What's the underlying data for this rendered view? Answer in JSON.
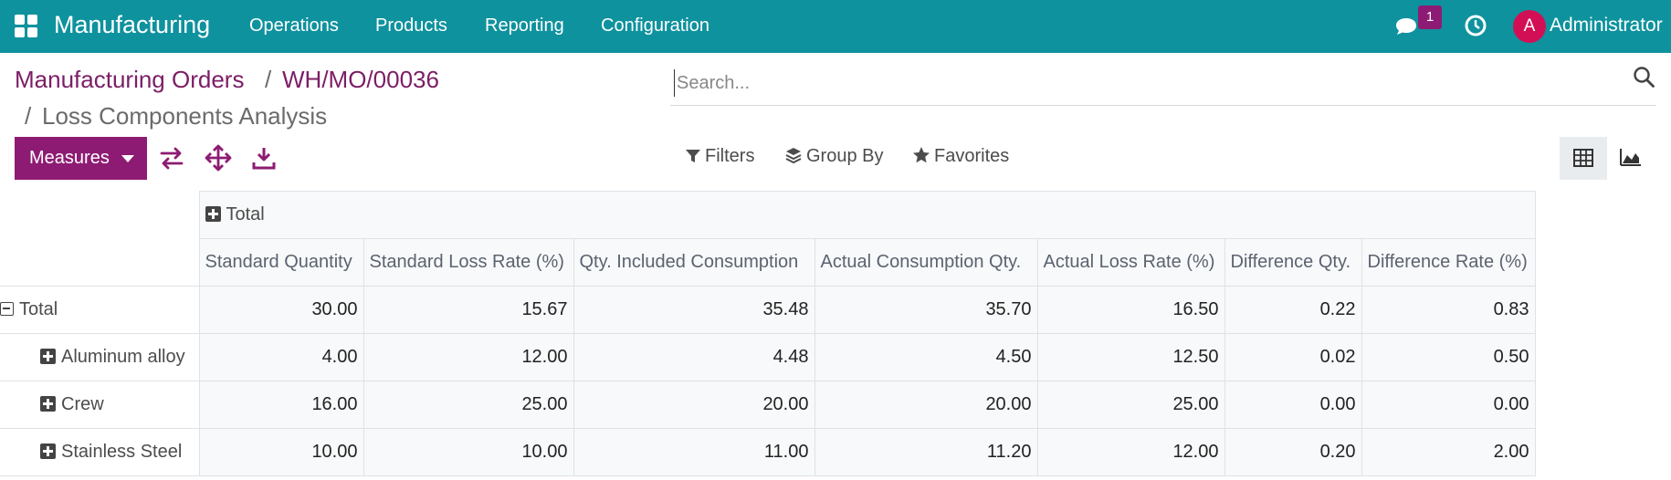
{
  "navbar": {
    "brand": "Manufacturing",
    "menu": [
      "Operations",
      "Products",
      "Reporting",
      "Configuration"
    ],
    "notification_count": "1",
    "avatar_initial": "A",
    "user": "Administrator",
    "bg_color": "#0e929e"
  },
  "breadcrumb": {
    "parent": "Manufacturing Orders",
    "sep": "/",
    "record": "WH/MO/00036",
    "current": "Loss Components Analysis"
  },
  "search": {
    "placeholder": "Search..."
  },
  "toolbar": {
    "measures": "Measures",
    "filters": "Filters",
    "group_by": "Group By",
    "favorites": "Favorites"
  },
  "pivot": {
    "col_group": "Total",
    "headers": [
      "Standard Quantity",
      "Standard Loss Rate (%)",
      "Qty. Included Consumption",
      "Actual Consumption Qty.",
      "Actual Loss Rate (%)",
      "Difference Qty.",
      "Difference Rate (%)"
    ],
    "total_label": "Total",
    "total_values": [
      "30.00",
      "15.67",
      "35.48",
      "35.70",
      "16.50",
      "0.22",
      "0.83"
    ],
    "rows": [
      {
        "label": "Aluminum alloy",
        "values": [
          "4.00",
          "12.00",
          "4.48",
          "4.50",
          "12.50",
          "0.02",
          "0.50"
        ]
      },
      {
        "label": "Crew",
        "values": [
          "16.00",
          "25.00",
          "20.00",
          "20.00",
          "25.00",
          "0.00",
          "0.00"
        ]
      },
      {
        "label": "Stainless Steel",
        "values": [
          "10.00",
          "10.00",
          "11.00",
          "11.20",
          "12.00",
          "0.20",
          "2.00"
        ]
      }
    ]
  },
  "colors": {
    "accent": "#8e1b73",
    "badge": "#8e1b73",
    "avatar": "#d20f55"
  }
}
